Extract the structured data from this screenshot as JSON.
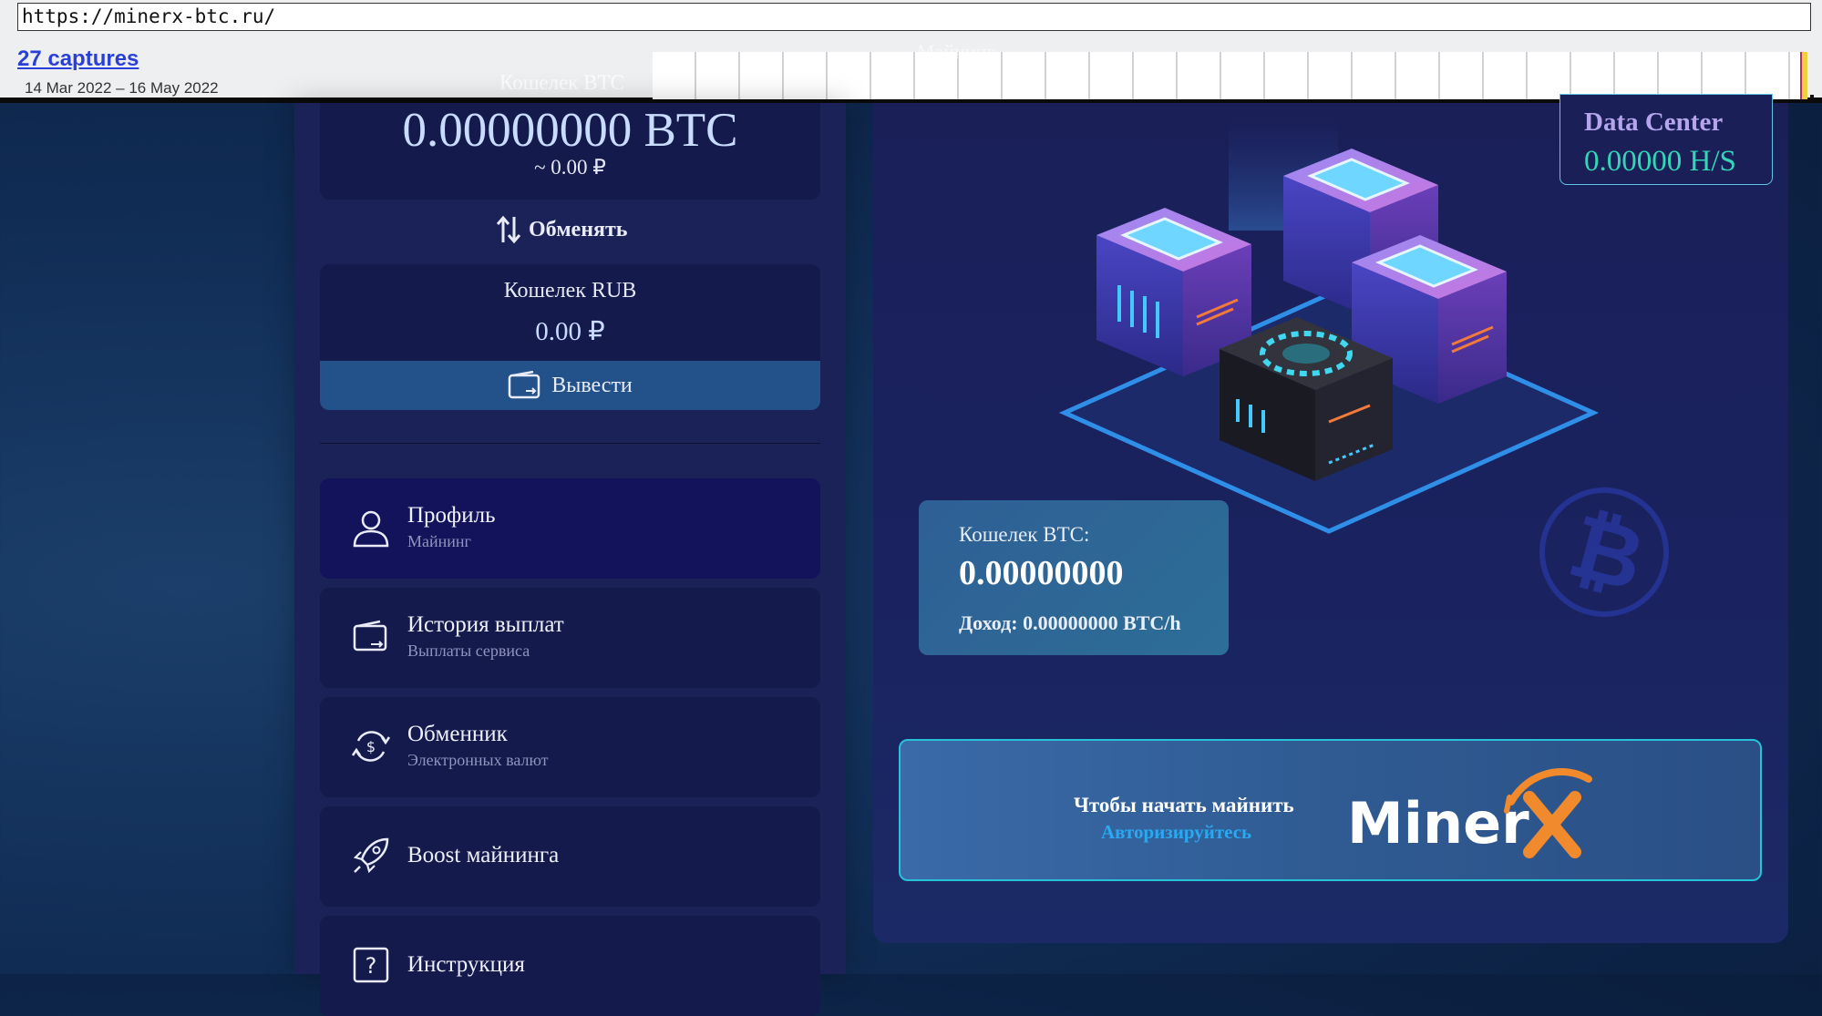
{
  "wayback": {
    "url": "https://minerx-btc.ru/",
    "captures": "27 captures",
    "range": "14 Mar 2022 – 16 May 2022"
  },
  "sidebar": {
    "btc_balance": "0.00000000 BTC",
    "btc_rub": "~ 0.00 ₽",
    "ghost_title": "Кошелек BTC",
    "exchange_label": "Обменять",
    "rub_wallet_title": "Кошелек RUB",
    "rub_balance": "0.00 ₽",
    "withdraw_label": "Вывести",
    "menu": [
      {
        "title": "Профиль",
        "subtitle": "Майнинг"
      },
      {
        "title": "История выплат",
        "subtitle": "Выплаты сервиса"
      },
      {
        "title": "Обменник",
        "subtitle": "Электронных валют"
      },
      {
        "title": "Boost майнинга",
        "subtitle": ""
      },
      {
        "title": "Инструкция",
        "subtitle": ""
      }
    ]
  },
  "main": {
    "ghost_heading": "Майнинг",
    "data_center_title": "Data Center",
    "data_center_rate": "0.00000 H/S",
    "wallet_label": "Кошелек BTC:",
    "wallet_value": "0.00000000",
    "wallet_income": "Доход: 0.00000000 BTC/h",
    "auth_prompt": "Чтобы начать майнить",
    "auth_link": "Авторизируйтесь",
    "logo_text": "MinerX"
  },
  "colors": {
    "accent_teal": "#33d7b8",
    "accent_blue": "#2aa9f2",
    "logo_orange": "#f08a2c"
  }
}
